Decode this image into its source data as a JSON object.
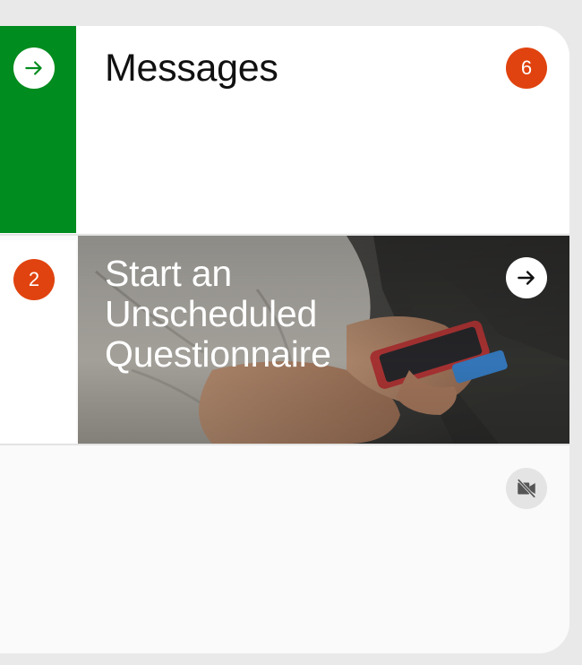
{
  "colors": {
    "page_bg": "#e9e9e9",
    "green_tile": "#008c1e",
    "badge": "#e0430f",
    "card_white": "#ffffff",
    "card_muted": "#fafafa"
  },
  "messages_tile": {
    "title": "Messages",
    "badge_count": "6",
    "icon": "arrow-right-icon"
  },
  "side_tile": {
    "badge_count": "2"
  },
  "questionnaire_tile": {
    "title_line_1": "Start an",
    "title_line_2": "Unscheduled",
    "title_line_3": "Questionnaire",
    "icon": "arrow-right-icon",
    "image": "hands-holding-phone-photo"
  },
  "video_tile": {
    "icon": "video-off-icon"
  }
}
